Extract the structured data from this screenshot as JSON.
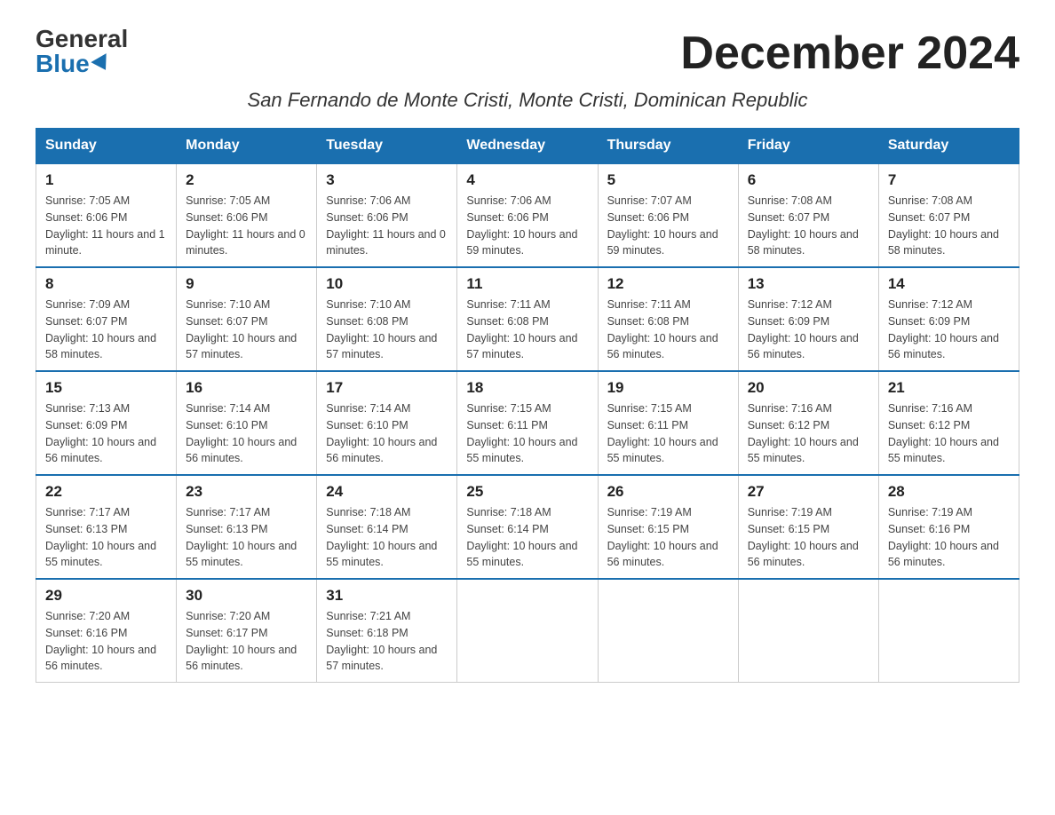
{
  "logo": {
    "general": "General",
    "blue": "Blue"
  },
  "page_title": "December 2024",
  "subtitle": "San Fernando de Monte Cristi, Monte Cristi, Dominican Republic",
  "days_of_week": [
    "Sunday",
    "Monday",
    "Tuesday",
    "Wednesday",
    "Thursday",
    "Friday",
    "Saturday"
  ],
  "weeks": [
    [
      {
        "day": "1",
        "sunrise": "7:05 AM",
        "sunset": "6:06 PM",
        "daylight": "11 hours and 1 minute."
      },
      {
        "day": "2",
        "sunrise": "7:05 AM",
        "sunset": "6:06 PM",
        "daylight": "11 hours and 0 minutes."
      },
      {
        "day": "3",
        "sunrise": "7:06 AM",
        "sunset": "6:06 PM",
        "daylight": "11 hours and 0 minutes."
      },
      {
        "day": "4",
        "sunrise": "7:06 AM",
        "sunset": "6:06 PM",
        "daylight": "10 hours and 59 minutes."
      },
      {
        "day": "5",
        "sunrise": "7:07 AM",
        "sunset": "6:06 PM",
        "daylight": "10 hours and 59 minutes."
      },
      {
        "day": "6",
        "sunrise": "7:08 AM",
        "sunset": "6:07 PM",
        "daylight": "10 hours and 58 minutes."
      },
      {
        "day": "7",
        "sunrise": "7:08 AM",
        "sunset": "6:07 PM",
        "daylight": "10 hours and 58 minutes."
      }
    ],
    [
      {
        "day": "8",
        "sunrise": "7:09 AM",
        "sunset": "6:07 PM",
        "daylight": "10 hours and 58 minutes."
      },
      {
        "day": "9",
        "sunrise": "7:10 AM",
        "sunset": "6:07 PM",
        "daylight": "10 hours and 57 minutes."
      },
      {
        "day": "10",
        "sunrise": "7:10 AM",
        "sunset": "6:08 PM",
        "daylight": "10 hours and 57 minutes."
      },
      {
        "day": "11",
        "sunrise": "7:11 AM",
        "sunset": "6:08 PM",
        "daylight": "10 hours and 57 minutes."
      },
      {
        "day": "12",
        "sunrise": "7:11 AM",
        "sunset": "6:08 PM",
        "daylight": "10 hours and 56 minutes."
      },
      {
        "day": "13",
        "sunrise": "7:12 AM",
        "sunset": "6:09 PM",
        "daylight": "10 hours and 56 minutes."
      },
      {
        "day": "14",
        "sunrise": "7:12 AM",
        "sunset": "6:09 PM",
        "daylight": "10 hours and 56 minutes."
      }
    ],
    [
      {
        "day": "15",
        "sunrise": "7:13 AM",
        "sunset": "6:09 PM",
        "daylight": "10 hours and 56 minutes."
      },
      {
        "day": "16",
        "sunrise": "7:14 AM",
        "sunset": "6:10 PM",
        "daylight": "10 hours and 56 minutes."
      },
      {
        "day": "17",
        "sunrise": "7:14 AM",
        "sunset": "6:10 PM",
        "daylight": "10 hours and 56 minutes."
      },
      {
        "day": "18",
        "sunrise": "7:15 AM",
        "sunset": "6:11 PM",
        "daylight": "10 hours and 55 minutes."
      },
      {
        "day": "19",
        "sunrise": "7:15 AM",
        "sunset": "6:11 PM",
        "daylight": "10 hours and 55 minutes."
      },
      {
        "day": "20",
        "sunrise": "7:16 AM",
        "sunset": "6:12 PM",
        "daylight": "10 hours and 55 minutes."
      },
      {
        "day": "21",
        "sunrise": "7:16 AM",
        "sunset": "6:12 PM",
        "daylight": "10 hours and 55 minutes."
      }
    ],
    [
      {
        "day": "22",
        "sunrise": "7:17 AM",
        "sunset": "6:13 PM",
        "daylight": "10 hours and 55 minutes."
      },
      {
        "day": "23",
        "sunrise": "7:17 AM",
        "sunset": "6:13 PM",
        "daylight": "10 hours and 55 minutes."
      },
      {
        "day": "24",
        "sunrise": "7:18 AM",
        "sunset": "6:14 PM",
        "daylight": "10 hours and 55 minutes."
      },
      {
        "day": "25",
        "sunrise": "7:18 AM",
        "sunset": "6:14 PM",
        "daylight": "10 hours and 55 minutes."
      },
      {
        "day": "26",
        "sunrise": "7:19 AM",
        "sunset": "6:15 PM",
        "daylight": "10 hours and 56 minutes."
      },
      {
        "day": "27",
        "sunrise": "7:19 AM",
        "sunset": "6:15 PM",
        "daylight": "10 hours and 56 minutes."
      },
      {
        "day": "28",
        "sunrise": "7:19 AM",
        "sunset": "6:16 PM",
        "daylight": "10 hours and 56 minutes."
      }
    ],
    [
      {
        "day": "29",
        "sunrise": "7:20 AM",
        "sunset": "6:16 PM",
        "daylight": "10 hours and 56 minutes."
      },
      {
        "day": "30",
        "sunrise": "7:20 AM",
        "sunset": "6:17 PM",
        "daylight": "10 hours and 56 minutes."
      },
      {
        "day": "31",
        "sunrise": "7:21 AM",
        "sunset": "6:18 PM",
        "daylight": "10 hours and 57 minutes."
      },
      null,
      null,
      null,
      null
    ]
  ]
}
